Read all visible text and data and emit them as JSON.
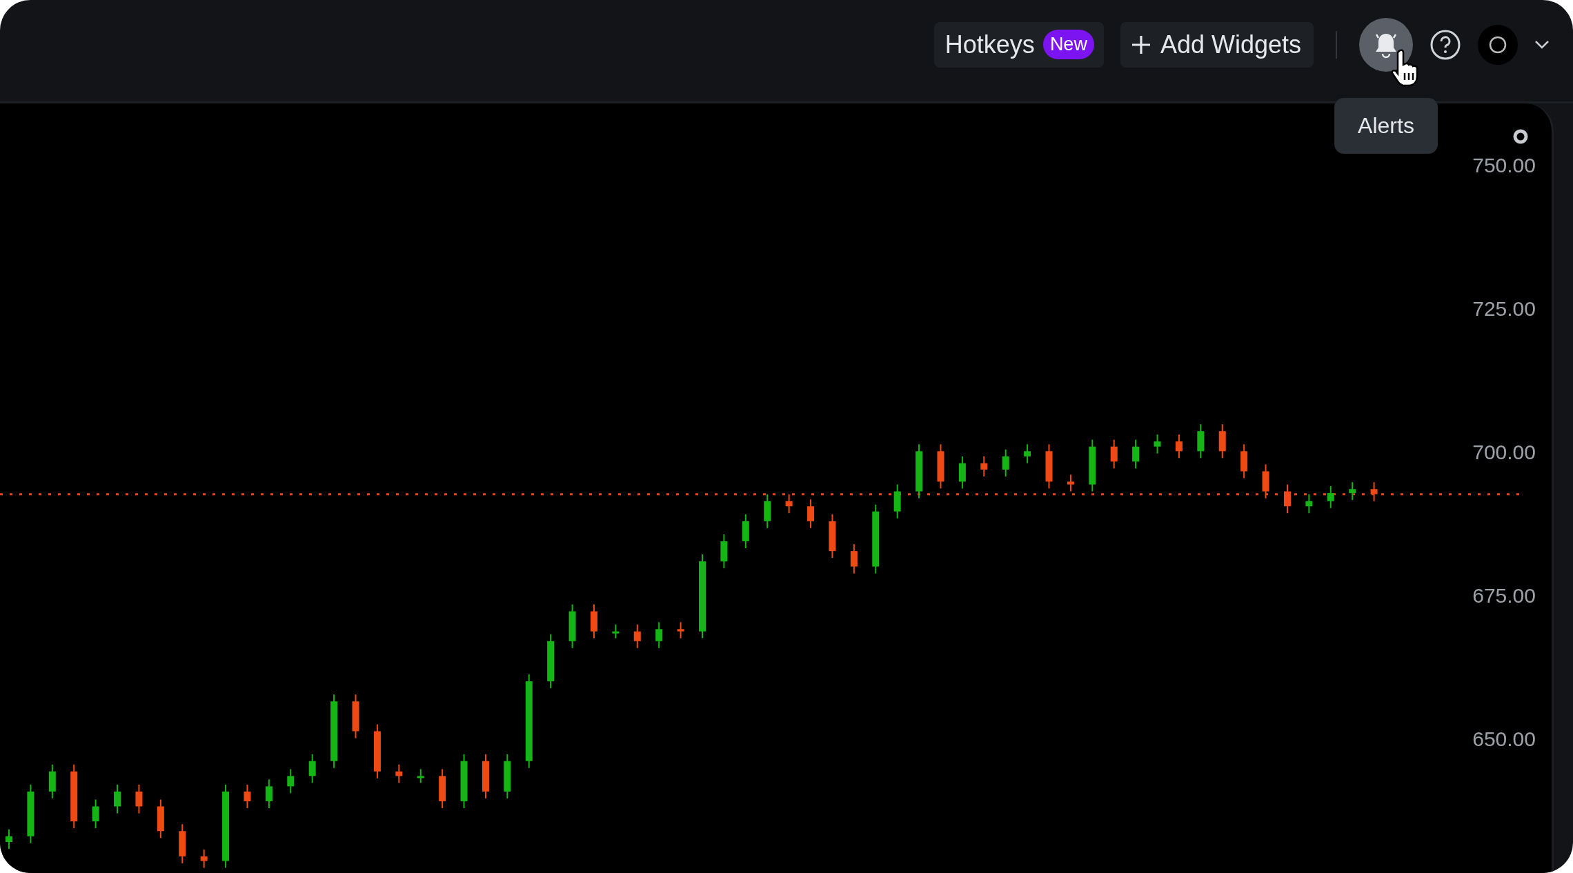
{
  "top_bar": {
    "hotkeys_button": {
      "label": "Hotkeys",
      "badge": "New"
    },
    "add_widgets_button": {
      "label": "Add Widgets"
    },
    "alerts_button": {
      "tooltip": "Alerts"
    }
  },
  "chart": {
    "chart_data": {
      "type": "candlestick",
      "ylim": [
        626.7,
        760.8
      ],
      "yticks": [
        {
          "value": 650,
          "label": "650.00"
        },
        {
          "value": 675,
          "label": "675.00"
        },
        {
          "value": 700,
          "label": "700.00"
        },
        {
          "value": 725,
          "label": "725.00"
        },
        {
          "value": 750,
          "label": "750.00"
        }
      ],
      "ohlc": [
        [
          632.1,
          634.3,
          630.9,
          633.1
        ],
        [
          633.1,
          642.1,
          631.9,
          640.9
        ],
        [
          640.9,
          645.6,
          639.7,
          644.4
        ],
        [
          644.4,
          645.6,
          634.5,
          635.7
        ],
        [
          635.7,
          639.5,
          634.5,
          638.3
        ],
        [
          638.3,
          642.1,
          637.1,
          640.9
        ],
        [
          640.9,
          642.1,
          637.1,
          638.3
        ],
        [
          638.3,
          639.5,
          632.8,
          634.0
        ],
        [
          634.0,
          635.2,
          628.4,
          629.6
        ],
        [
          629.6,
          630.8,
          627.6,
          628.8
        ],
        [
          628.8,
          642.1,
          627.6,
          640.9
        ],
        [
          640.9,
          642.1,
          638.0,
          639.2
        ],
        [
          639.2,
          643.0,
          638.0,
          641.8
        ],
        [
          641.8,
          644.8,
          640.6,
          643.6
        ],
        [
          643.6,
          647.4,
          642.4,
          646.2
        ],
        [
          646.2,
          657.8,
          645.0,
          656.6
        ],
        [
          656.6,
          657.8,
          650.2,
          651.4
        ],
        [
          651.4,
          652.6,
          643.2,
          644.4
        ],
        [
          644.4,
          645.6,
          642.4,
          643.6
        ],
        [
          643.6,
          644.8,
          642.4,
          643.6
        ],
        [
          643.6,
          644.8,
          638.0,
          639.2
        ],
        [
          639.2,
          647.4,
          638.0,
          646.2
        ],
        [
          646.2,
          647.4,
          639.7,
          640.9
        ],
        [
          640.9,
          647.4,
          639.7,
          646.2
        ],
        [
          646.2,
          661.3,
          645.0,
          660.1
        ],
        [
          660.1,
          668.3,
          658.9,
          667.1
        ],
        [
          667.1,
          673.5,
          665.9,
          672.3
        ],
        [
          672.3,
          673.5,
          667.6,
          668.8
        ],
        [
          668.8,
          670.0,
          667.6,
          668.8
        ],
        [
          668.8,
          670.0,
          665.9,
          667.1
        ],
        [
          667.1,
          670.4,
          665.9,
          669.2
        ],
        [
          669.2,
          670.4,
          667.6,
          668.8
        ],
        [
          668.8,
          682.2,
          667.6,
          681.0
        ],
        [
          681.0,
          685.7,
          679.8,
          684.5
        ],
        [
          684.5,
          689.2,
          683.3,
          688.0
        ],
        [
          688.0,
          692.7,
          686.8,
          691.5
        ],
        [
          691.5,
          692.7,
          689.4,
          690.6
        ],
        [
          690.6,
          691.8,
          686.8,
          688.0
        ],
        [
          688.0,
          689.2,
          681.6,
          682.8
        ],
        [
          682.8,
          684.0,
          678.9,
          680.1
        ],
        [
          680.1,
          690.9,
          678.9,
          689.7
        ],
        [
          689.7,
          694.4,
          688.5,
          693.2
        ],
        [
          693.2,
          701.4,
          692.0,
          700.2
        ],
        [
          700.2,
          701.4,
          693.7,
          694.9
        ],
        [
          694.9,
          699.3,
          693.7,
          698.1
        ],
        [
          698.1,
          699.3,
          695.8,
          697.0
        ],
        [
          697.0,
          700.5,
          695.8,
          699.3
        ],
        [
          699.3,
          701.4,
          698.1,
          700.2
        ],
        [
          700.2,
          701.4,
          693.7,
          694.9
        ],
        [
          694.9,
          696.1,
          693.2,
          694.4
        ],
        [
          694.4,
          702.2,
          693.2,
          701.0
        ],
        [
          701.0,
          702.2,
          697.2,
          698.4
        ],
        [
          698.4,
          702.2,
          697.2,
          701.0
        ],
        [
          701.0,
          703.1,
          699.8,
          701.9
        ],
        [
          701.9,
          703.1,
          699.0,
          700.2
        ],
        [
          700.2,
          704.9,
          699.0,
          703.7
        ],
        [
          703.7,
          704.9,
          699.0,
          700.2
        ],
        [
          700.2,
          701.4,
          695.5,
          696.7
        ],
        [
          696.7,
          697.9,
          692.0,
          693.2
        ],
        [
          693.2,
          694.4,
          689.4,
          690.6
        ],
        [
          690.6,
          692.7,
          689.4,
          691.5
        ],
        [
          691.5,
          694.1,
          690.3,
          692.9
        ],
        [
          692.9,
          694.8,
          691.7,
          693.6
        ],
        [
          693.6,
          694.8,
          691.5,
          692.7
        ]
      ],
      "ref_lines": [
        {
          "axis": "y",
          "value": 692.7
        }
      ]
    }
  }
}
